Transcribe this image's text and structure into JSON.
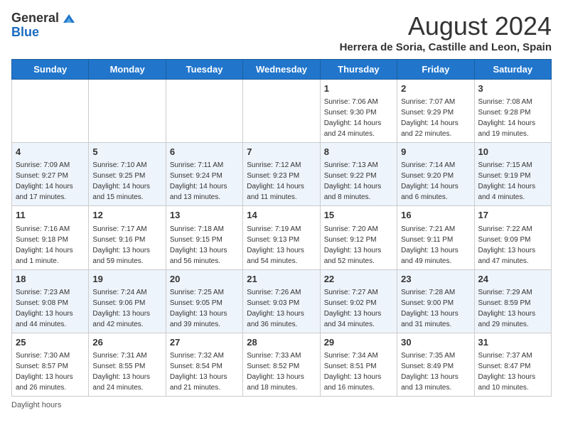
{
  "header": {
    "logo_general": "General",
    "logo_blue": "Blue",
    "title": "August 2024",
    "subtitle": "Herrera de Soria, Castille and Leon, Spain"
  },
  "days_of_week": [
    "Sunday",
    "Monday",
    "Tuesday",
    "Wednesday",
    "Thursday",
    "Friday",
    "Saturday"
  ],
  "weeks": [
    [
      {
        "day": "",
        "info": ""
      },
      {
        "day": "",
        "info": ""
      },
      {
        "day": "",
        "info": ""
      },
      {
        "day": "",
        "info": ""
      },
      {
        "day": "1",
        "info": "Sunrise: 7:06 AM\nSunset: 9:30 PM\nDaylight: 14 hours and 24 minutes."
      },
      {
        "day": "2",
        "info": "Sunrise: 7:07 AM\nSunset: 9:29 PM\nDaylight: 14 hours and 22 minutes."
      },
      {
        "day": "3",
        "info": "Sunrise: 7:08 AM\nSunset: 9:28 PM\nDaylight: 14 hours and 19 minutes."
      }
    ],
    [
      {
        "day": "4",
        "info": "Sunrise: 7:09 AM\nSunset: 9:27 PM\nDaylight: 14 hours and 17 minutes."
      },
      {
        "day": "5",
        "info": "Sunrise: 7:10 AM\nSunset: 9:25 PM\nDaylight: 14 hours and 15 minutes."
      },
      {
        "day": "6",
        "info": "Sunrise: 7:11 AM\nSunset: 9:24 PM\nDaylight: 14 hours and 13 minutes."
      },
      {
        "day": "7",
        "info": "Sunrise: 7:12 AM\nSunset: 9:23 PM\nDaylight: 14 hours and 11 minutes."
      },
      {
        "day": "8",
        "info": "Sunrise: 7:13 AM\nSunset: 9:22 PM\nDaylight: 14 hours and 8 minutes."
      },
      {
        "day": "9",
        "info": "Sunrise: 7:14 AM\nSunset: 9:20 PM\nDaylight: 14 hours and 6 minutes."
      },
      {
        "day": "10",
        "info": "Sunrise: 7:15 AM\nSunset: 9:19 PM\nDaylight: 14 hours and 4 minutes."
      }
    ],
    [
      {
        "day": "11",
        "info": "Sunrise: 7:16 AM\nSunset: 9:18 PM\nDaylight: 14 hours and 1 minute."
      },
      {
        "day": "12",
        "info": "Sunrise: 7:17 AM\nSunset: 9:16 PM\nDaylight: 13 hours and 59 minutes."
      },
      {
        "day": "13",
        "info": "Sunrise: 7:18 AM\nSunset: 9:15 PM\nDaylight: 13 hours and 56 minutes."
      },
      {
        "day": "14",
        "info": "Sunrise: 7:19 AM\nSunset: 9:13 PM\nDaylight: 13 hours and 54 minutes."
      },
      {
        "day": "15",
        "info": "Sunrise: 7:20 AM\nSunset: 9:12 PM\nDaylight: 13 hours and 52 minutes."
      },
      {
        "day": "16",
        "info": "Sunrise: 7:21 AM\nSunset: 9:11 PM\nDaylight: 13 hours and 49 minutes."
      },
      {
        "day": "17",
        "info": "Sunrise: 7:22 AM\nSunset: 9:09 PM\nDaylight: 13 hours and 47 minutes."
      }
    ],
    [
      {
        "day": "18",
        "info": "Sunrise: 7:23 AM\nSunset: 9:08 PM\nDaylight: 13 hours and 44 minutes."
      },
      {
        "day": "19",
        "info": "Sunrise: 7:24 AM\nSunset: 9:06 PM\nDaylight: 13 hours and 42 minutes."
      },
      {
        "day": "20",
        "info": "Sunrise: 7:25 AM\nSunset: 9:05 PM\nDaylight: 13 hours and 39 minutes."
      },
      {
        "day": "21",
        "info": "Sunrise: 7:26 AM\nSunset: 9:03 PM\nDaylight: 13 hours and 36 minutes."
      },
      {
        "day": "22",
        "info": "Sunrise: 7:27 AM\nSunset: 9:02 PM\nDaylight: 13 hours and 34 minutes."
      },
      {
        "day": "23",
        "info": "Sunrise: 7:28 AM\nSunset: 9:00 PM\nDaylight: 13 hours and 31 minutes."
      },
      {
        "day": "24",
        "info": "Sunrise: 7:29 AM\nSunset: 8:59 PM\nDaylight: 13 hours and 29 minutes."
      }
    ],
    [
      {
        "day": "25",
        "info": "Sunrise: 7:30 AM\nSunset: 8:57 PM\nDaylight: 13 hours and 26 minutes."
      },
      {
        "day": "26",
        "info": "Sunrise: 7:31 AM\nSunset: 8:55 PM\nDaylight: 13 hours and 24 minutes."
      },
      {
        "day": "27",
        "info": "Sunrise: 7:32 AM\nSunset: 8:54 PM\nDaylight: 13 hours and 21 minutes."
      },
      {
        "day": "28",
        "info": "Sunrise: 7:33 AM\nSunset: 8:52 PM\nDaylight: 13 hours and 18 minutes."
      },
      {
        "day": "29",
        "info": "Sunrise: 7:34 AM\nSunset: 8:51 PM\nDaylight: 13 hours and 16 minutes."
      },
      {
        "day": "30",
        "info": "Sunrise: 7:35 AM\nSunset: 8:49 PM\nDaylight: 13 hours and 13 minutes."
      },
      {
        "day": "31",
        "info": "Sunrise: 7:37 AM\nSunset: 8:47 PM\nDaylight: 13 hours and 10 minutes."
      }
    ]
  ],
  "footer": {
    "note": "Daylight hours"
  }
}
